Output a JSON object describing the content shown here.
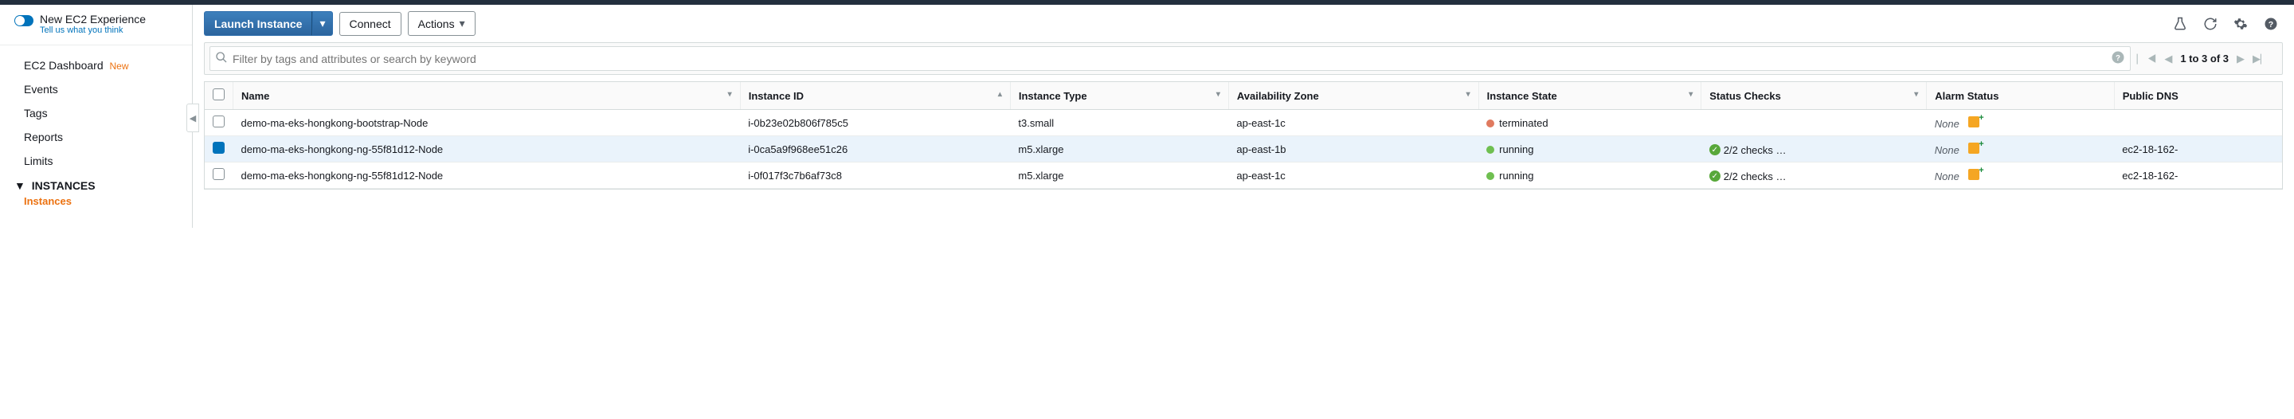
{
  "new_experience": {
    "title": "New EC2 Experience",
    "subtitle": "Tell us what you think"
  },
  "sidebar": {
    "items": [
      {
        "label": "EC2 Dashboard",
        "new": true
      },
      {
        "label": "Events"
      },
      {
        "label": "Tags"
      },
      {
        "label": "Reports"
      },
      {
        "label": "Limits"
      }
    ],
    "group_label": "INSTANCES",
    "sub_item": "Instances"
  },
  "toolbar": {
    "launch_label": "Launch Instance",
    "connect_label": "Connect",
    "actions_label": "Actions"
  },
  "search": {
    "placeholder": "Filter by tags and attributes or search by keyword"
  },
  "pager": {
    "text": "1 to 3 of 3"
  },
  "table": {
    "headers": {
      "name": "Name",
      "instance_id": "Instance ID",
      "instance_type": "Instance Type",
      "az": "Availability Zone",
      "state": "Instance State",
      "status": "Status Checks",
      "alarm": "Alarm Status",
      "dns": "Public DNS"
    },
    "rows": [
      {
        "selected": false,
        "name": "demo-ma-eks-hongkong-bootstrap-Node",
        "id": "i-0b23e02b806f785c5",
        "type": "t3.small",
        "az": "ap-east-1c",
        "state": "terminated",
        "state_color": "state-red",
        "status": "",
        "has_status": false,
        "alarm": "None",
        "dns": ""
      },
      {
        "selected": true,
        "name": "demo-ma-eks-hongkong-ng-55f81d12-Node",
        "id": "i-0ca5a9f968ee51c26",
        "type": "m5.xlarge",
        "az": "ap-east-1b",
        "state": "running",
        "state_color": "state-green",
        "status": "2/2 checks …",
        "has_status": true,
        "alarm": "None",
        "dns": "ec2-18-162-"
      },
      {
        "selected": false,
        "name": "demo-ma-eks-hongkong-ng-55f81d12-Node",
        "id": "i-0f017f3c7b6af73c8",
        "type": "m5.xlarge",
        "az": "ap-east-1c",
        "state": "running",
        "state_color": "state-green",
        "status": "2/2 checks …",
        "has_status": true,
        "alarm": "None",
        "dns": "ec2-18-162-"
      }
    ]
  },
  "new_label": "New"
}
